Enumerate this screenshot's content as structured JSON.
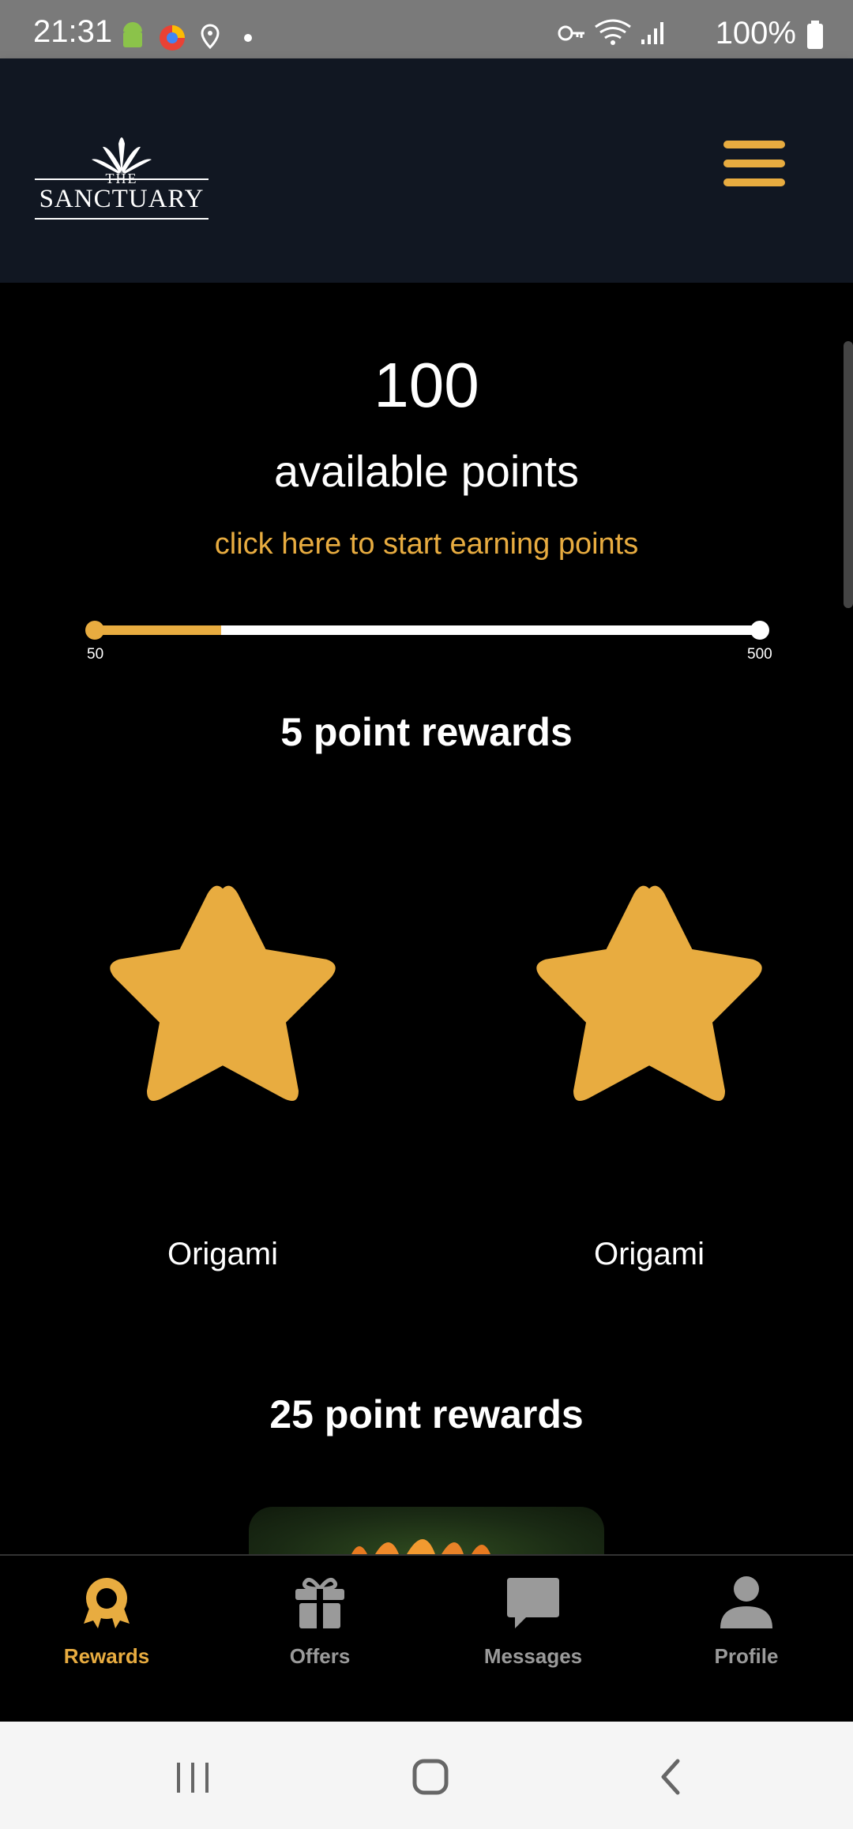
{
  "status_bar": {
    "time": "21:31",
    "battery": "100%"
  },
  "header": {
    "logo_the": "THE",
    "logo_name": "SANCTUARY",
    "menu_icon": "hamburger-menu-icon"
  },
  "points": {
    "value": "100",
    "label": "available points",
    "earn_link": "click here to start earning points",
    "progress_min": "50",
    "progress_max": "500",
    "progress_fraction": 0.19
  },
  "sections": [
    {
      "title": "5 point rewards",
      "rewards": [
        {
          "name": "Origami",
          "icon": "star-icon"
        },
        {
          "name": "Origami",
          "icon": "star-icon"
        }
      ]
    },
    {
      "title": "25 point rewards",
      "rewards": []
    }
  ],
  "bottom_nav": [
    {
      "label": "Rewards",
      "icon": "award-icon",
      "active": true
    },
    {
      "label": "Offers",
      "icon": "gift-icon",
      "active": false
    },
    {
      "label": "Messages",
      "icon": "message-icon",
      "active": false
    },
    {
      "label": "Profile",
      "icon": "person-icon",
      "active": false
    }
  ],
  "colors": {
    "accent": "#e8ac40",
    "header_bg": "#111722",
    "background": "#000000",
    "inactive": "#9a9a9a"
  }
}
